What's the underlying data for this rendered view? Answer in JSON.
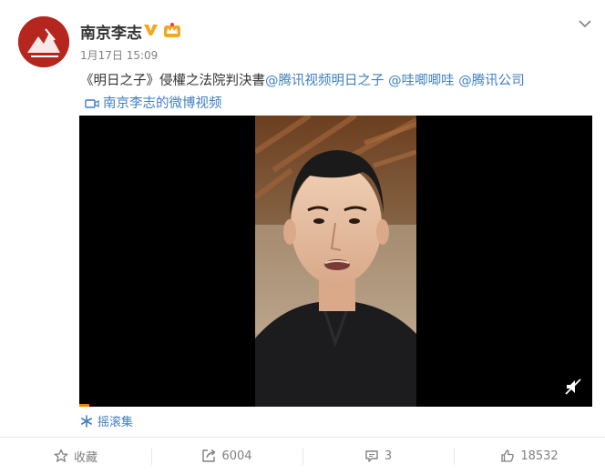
{
  "user": {
    "name": "南京李志",
    "timestamp": "1月17日 15:09"
  },
  "post": {
    "text_plain": "《明日之子》侵權之法院判決書",
    "mentions": [
      "@腾讯视频明日之子",
      "@哇唧唧哇",
      "@腾讯公司"
    ],
    "video_link": "南京李志的微博视频",
    "playlist_label": "摇滚集"
  },
  "actions": {
    "favorite": "收藏",
    "repost_count": "6004",
    "comment_count": "3",
    "like_count": "18532"
  },
  "colors": {
    "mention": "#3f7fc1",
    "accent_orange": "#eb7350",
    "avatar_red": "#b5261e",
    "verified_gold": "#f5a623"
  },
  "icons": {
    "verified": "verified-v-icon",
    "vip": "vip-crown-icon",
    "menu": "chevron-down-icon",
    "video": "video-camera-icon",
    "mute": "volume-muted-icon",
    "playlist": "snowflake-icon",
    "favorite": "star-outline-icon",
    "repost": "share-arrow-icon",
    "comment": "comment-bubble-icon",
    "like": "thumbs-up-icon"
  },
  "video": {
    "progress_fraction": 0.02
  }
}
